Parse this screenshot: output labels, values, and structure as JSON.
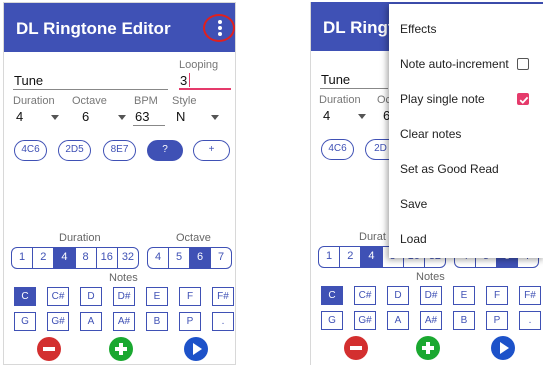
{
  "app": {
    "title": "DL Ringtone Editor",
    "title_truncated": "DL Ringto"
  },
  "colors": {
    "primary": "#3f51b5",
    "accent": "#e53a6b",
    "annotation_ring": "#e0201e",
    "delete": "#d32f2f",
    "add": "#1aa830",
    "play": "#1d52c9"
  },
  "icons": {
    "overflow": "more-vert-icon",
    "delete": "minus-circle-icon",
    "add": "plus-circle-icon",
    "play": "play-icon",
    "dropdown": "dropdown-arrow-icon",
    "checkbox": "check-icon"
  },
  "fields": {
    "name": {
      "value": "Tune"
    },
    "looping": {
      "label": "Looping",
      "value": "3"
    },
    "duration": {
      "label": "Duration",
      "value": "4"
    },
    "octave": {
      "label": "Octave",
      "value": "6"
    },
    "bpm": {
      "label": "BPM",
      "value": "63"
    },
    "style": {
      "label": "Style",
      "value": "N"
    }
  },
  "chips": [
    "4C6",
    "2D5",
    "8E7",
    "?",
    "+"
  ],
  "duration_selector": {
    "label": "Duration",
    "options": [
      "1",
      "2",
      "4",
      "8",
      "16",
      "32"
    ],
    "selected": "4"
  },
  "octave_selector": {
    "label": "Octave",
    "options": [
      "4",
      "5",
      "6",
      "7"
    ],
    "selected": "6"
  },
  "notes": {
    "label": "Notes",
    "row1": [
      "C",
      "C#",
      "D",
      "D#",
      "E",
      "F",
      "F#"
    ],
    "row2": [
      "G",
      "G#",
      "A",
      "A#",
      "B",
      "P",
      "."
    ],
    "selected": "C"
  },
  "menu": {
    "items": [
      {
        "label": "Effects"
      },
      {
        "label": "Note auto-increment",
        "checkbox": true,
        "checked": false
      },
      {
        "label": "Play single note",
        "checkbox": true,
        "checked": true
      },
      {
        "label": "Clear notes"
      },
      {
        "label": "Set as Good Read"
      },
      {
        "label": "Save"
      },
      {
        "label": "Load"
      }
    ]
  },
  "right_partial": {
    "duration_label": "Durat",
    "duration_options": [
      "1",
      "2",
      "4",
      "8",
      "16",
      "32"
    ],
    "octave_options": [
      "4",
      "5",
      "6",
      "7"
    ],
    "notes_label": "Notes",
    "octave_peek": "Oc",
    "octave_value_peek": "6",
    "chip_peek": "2D"
  }
}
